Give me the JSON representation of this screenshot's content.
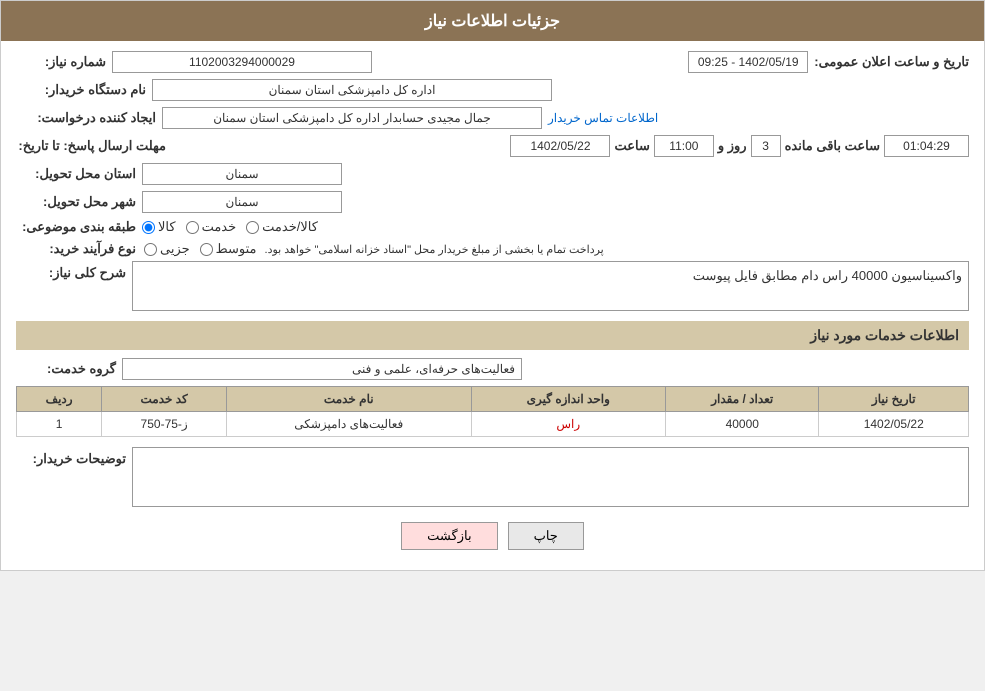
{
  "header": {
    "title": "جزئیات اطلاعات نیاز"
  },
  "fields": {
    "need_number_label": "شماره نیاز:",
    "need_number_value": "1102003294000029",
    "buyer_org_label": "نام دستگاه خریدار:",
    "buyer_org_value": "اداره کل دامپزشکی استان سمنان",
    "creator_label": "ایجاد کننده درخواست:",
    "creator_value": "جمال مجیدی حسابدار اداره کل دامپزشکی استان سمنان",
    "contact_info_label": "اطلاعات تماس خریدار",
    "publish_datetime_label": "تاریخ و ساعت اعلان عمومی:",
    "publish_datetime_value": "1402/05/19 - 09:25",
    "response_deadline_label": "مهلت ارسال پاسخ: تا تاریخ:",
    "response_date": "1402/05/22",
    "response_time_label": "ساعت",
    "response_time": "11:00",
    "response_days_label": "روز و",
    "response_days": "3",
    "response_remaining_label": "ساعت باقی مانده",
    "response_remaining": "01:04:29",
    "province_label": "استان محل تحویل:",
    "province_value": "سمنان",
    "city_label": "شهر محل تحویل:",
    "city_value": "سمنان",
    "category_label": "طبقه بندی موضوعی:",
    "radio_goods": "کالا",
    "radio_service": "خدمت",
    "radio_goods_service": "کالا/خدمت",
    "purchase_type_label": "نوع فرآیند خرید:",
    "radio_partial": "جزیی",
    "radio_medium": "متوسط",
    "purchase_note": "پرداخت تمام یا بخشی از مبلغ خریدار محل \"اسناد خزانه اسلامی\" خواهد بود.",
    "description_label": "شرح کلی نیاز:",
    "description_value": "واکسیناسیون 40000 راس دام مطابق فایل پیوست",
    "service_info_title": "اطلاعات خدمات مورد نیاز",
    "service_group_label": "گروه خدمت:",
    "service_group_value": "فعالیت‌های حرفه‌ای، علمی و فنی",
    "buyer_notes_label": "توضیحات خریدار:"
  },
  "table": {
    "columns": [
      "ردیف",
      "کد خدمت",
      "نام خدمت",
      "واحد اندازه گیری",
      "تعداد / مقدار",
      "تاریخ نیاز"
    ],
    "rows": [
      {
        "row": "1",
        "code": "ز-75-750",
        "name": "فعالیت‌های دامپزشکی",
        "unit": "راس",
        "quantity": "40000",
        "date": "1402/05/22"
      }
    ]
  },
  "buttons": {
    "print": "چاپ",
    "back": "بازگشت"
  }
}
